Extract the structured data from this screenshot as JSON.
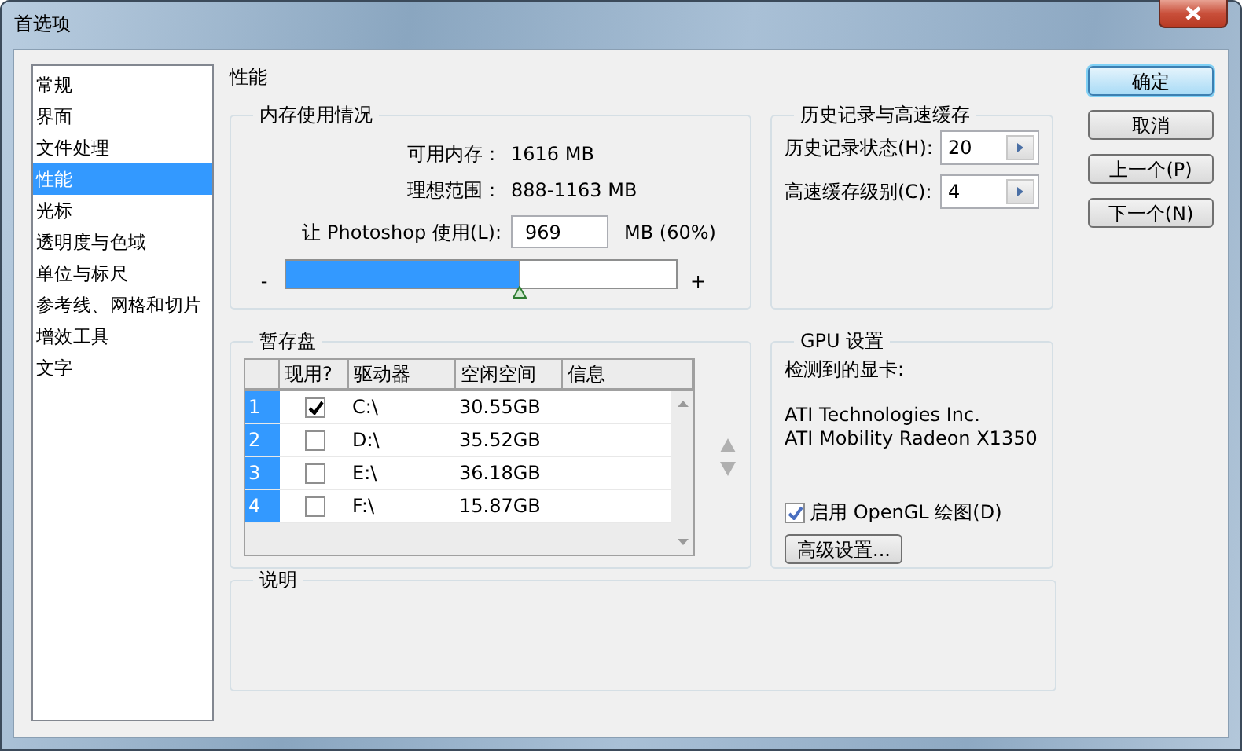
{
  "window": {
    "title": "首选项"
  },
  "sidebar": {
    "items": [
      {
        "label": "常规",
        "selected": false
      },
      {
        "label": "界面",
        "selected": false
      },
      {
        "label": "文件处理",
        "selected": false
      },
      {
        "label": "性能",
        "selected": true
      },
      {
        "label": "光标",
        "selected": false
      },
      {
        "label": "透明度与色域",
        "selected": false
      },
      {
        "label": "单位与标尺",
        "selected": false
      },
      {
        "label": "参考线、网格和切片",
        "selected": false
      },
      {
        "label": "增效工具",
        "selected": false
      },
      {
        "label": "文字",
        "selected": false
      }
    ]
  },
  "section_title": "性能",
  "memory": {
    "title": "内存使用情况",
    "available_label": "可用内存：",
    "available_value": "1616 MB",
    "ideal_label": "理想范围：",
    "ideal_value": "888-1163 MB",
    "use_label": "让 Photoshop 使用(L):",
    "use_value": "969",
    "use_unit": "MB (60%)",
    "slider": {
      "minus": "-",
      "plus": "+",
      "level": 0.6
    }
  },
  "history": {
    "title": "历史记录与高速缓存",
    "fields": [
      {
        "label": "历史记录状态(H):",
        "value": "20"
      },
      {
        "label": "高速缓存级别(C):",
        "value": "4"
      }
    ]
  },
  "scratch": {
    "title": "暂存盘",
    "columns": [
      "现用?",
      "驱动器",
      "空闲空间",
      "信息"
    ],
    "rows": [
      {
        "index": "1",
        "active": true,
        "drive": "C:\\",
        "free": "30.55GB"
      },
      {
        "index": "2",
        "active": false,
        "drive": "D:\\",
        "free": "35.52GB"
      },
      {
        "index": "3",
        "active": false,
        "drive": "E:\\",
        "free": "36.18GB"
      },
      {
        "index": "4",
        "active": false,
        "drive": "F:\\",
        "free": "15.87GB"
      }
    ]
  },
  "gpu": {
    "title": "GPU 设置",
    "detected_label": "检测到的显卡:",
    "card_lines": [
      "ATI Technologies Inc.",
      "ATI Mobility Radeon X1350"
    ],
    "opengl": {
      "label": "启用 OpenGL 绘图(D)",
      "checked": true
    },
    "advanced_button": "高级设置..."
  },
  "description": {
    "title": "说明"
  },
  "buttons": [
    {
      "label": "确定",
      "default": true
    },
    {
      "label": "取消",
      "default": false
    },
    {
      "label": "上一个(P)",
      "default": false
    },
    {
      "label": "下一个(N)",
      "default": false
    }
  ]
}
